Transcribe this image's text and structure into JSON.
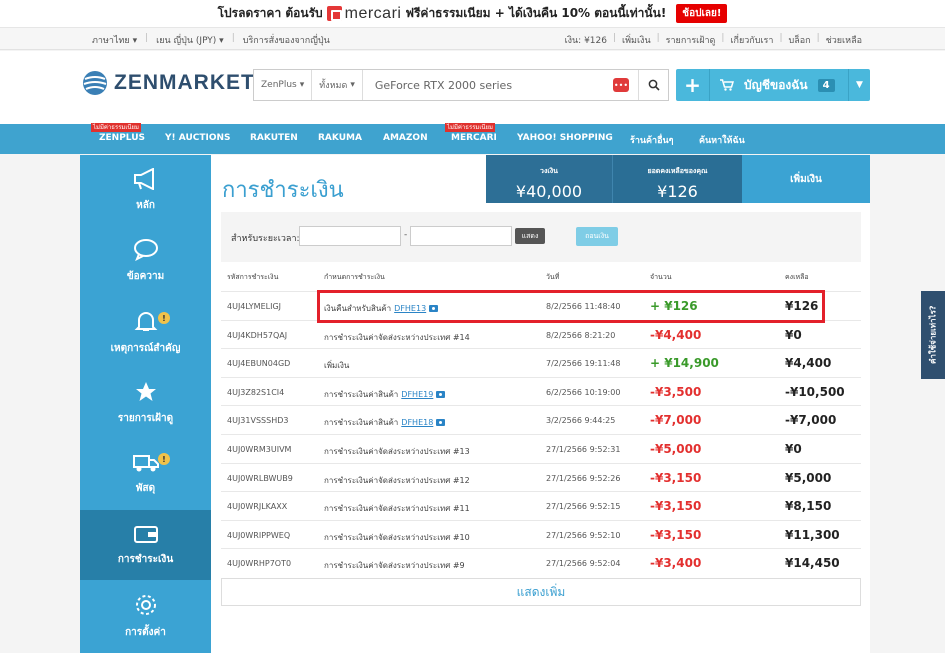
{
  "promo": {
    "prefix": "โปรลดราคา ต้อนรับ",
    "brand": "mercari",
    "suffix": "ฟรีค่าธรรมเนียม + ได้เงินคืน 10% ตอนนี้เท่านั้น!",
    "cta": "ช้อปเลย!"
  },
  "topbar": {
    "language": "ภาษาไทย ▾",
    "currency": "เยน ญี่ปุ่น (JPY) ▾",
    "service": "บริการสั่งของจากญี่ปุ่น",
    "links": [
      "เงิน: ¥126",
      "เพิ่มเงิน",
      "รายการเฝ้าดู",
      "เกี่ยวกับเรา",
      "บล็อก",
      "ช่วยเหลือ"
    ]
  },
  "header": {
    "logo": "ZENMARKET",
    "store_select": "ZenPlus",
    "category_select": "ทั้งหมด",
    "search_value": "GeForce RTX 2000 series",
    "account_label": "บัญชีของฉัน",
    "cart_count": "4"
  },
  "nav": {
    "items": [
      "ZENPLUS",
      "Y! AUCTIONS",
      "RAKUTEN",
      "RAKUMA",
      "AMAZON",
      "MERCARI",
      "YAHOO! SHOPPING",
      "ร้านค้าอื่นๆ",
      "ค้นหาให้ฉัน"
    ],
    "badge": "ไม่มีค่าธรรมเนียม"
  },
  "sidebar": {
    "items": [
      "หลัก",
      "ข้อความ",
      "เหตุการณ์สำคัญ",
      "รายการเฝ้าดู",
      "พัสดุ",
      "การชำระเงิน",
      "การตั้งค่า"
    ],
    "notif_count": "!"
  },
  "page": {
    "title": "การชำระเงิน",
    "credit_label": "วงเงิน",
    "credit_value": "¥40,000",
    "balance_label": "ยอดคงเหลือของคุณ",
    "balance_value": "¥126",
    "add_funds": "เพิ่มเงิน"
  },
  "filter": {
    "label": "สำหรับระยะเวลา:",
    "dash": "-",
    "show": "แสดง",
    "withdraw": "ถอนเงิน"
  },
  "table": {
    "headers": [
      "รหัสการชำระเงิน",
      "กำหนดการชำระเงิน",
      "วันที่",
      "จำนวน",
      "คงเหลือ"
    ],
    "rows": [
      {
        "id": "4UJ4LYMELIGJ",
        "desc": "เงินคืนสำหรับสินค้า",
        "link": "DFHE13",
        "date": "8/2/2566 11:48:40",
        "amount": "+ ¥126",
        "balance": "¥126"
      },
      {
        "id": "4UJ4KDH57QAJ",
        "desc": "การชำระเงินค่าจัดส่งระหว่างประเทศ #14",
        "link": "",
        "date": "8/2/2566 8:21:20",
        "amount": "-¥4,400",
        "balance": "¥0"
      },
      {
        "id": "4UJ4EBUN04GD",
        "desc": "เพิ่มเงิน",
        "link": "",
        "date": "7/2/2566 19:11:48",
        "amount": "+ ¥14,900",
        "balance": "¥4,400"
      },
      {
        "id": "4UJ3Z82S1CI4",
        "desc": "การชำระเงินค่าสินค้า",
        "link": "DFHE19",
        "date": "6/2/2566 10:19:00",
        "amount": "-¥3,500",
        "balance": "-¥10,500"
      },
      {
        "id": "4UJ31VSSSHD3",
        "desc": "การชำระเงินค่าสินค้า",
        "link": "DFHE18",
        "date": "3/2/2566 9:44:25",
        "amount": "-¥7,000",
        "balance": "-¥7,000"
      },
      {
        "id": "4UJ0WRM3UIVM",
        "desc": "การชำระเงินค่าจัดส่งระหว่างประเทศ #13",
        "link": "",
        "date": "27/1/2566 9:52:31",
        "amount": "-¥5,000",
        "balance": "¥0"
      },
      {
        "id": "4UJ0WRLBWUB9",
        "desc": "การชำระเงินค่าจัดส่งระหว่างประเทศ #12",
        "link": "",
        "date": "27/1/2566 9:52:26",
        "amount": "-¥3,150",
        "balance": "¥5,000"
      },
      {
        "id": "4UJ0WRJLKAXX",
        "desc": "การชำระเงินค่าจัดส่งระหว่างประเทศ #11",
        "link": "",
        "date": "27/1/2566 9:52:15",
        "amount": "-¥3,150",
        "balance": "¥8,150"
      },
      {
        "id": "4UJ0WRIPPWEQ",
        "desc": "การชำระเงินค่าจัดส่งระหว่างประเทศ #10",
        "link": "",
        "date": "27/1/2566 9:52:10",
        "amount": "-¥3,150",
        "balance": "¥11,300"
      },
      {
        "id": "4UJ0WRHP7OT0",
        "desc": "การชำระเงินค่าจัดส่งระหว่างประเทศ #9",
        "link": "",
        "date": "27/1/2566 9:52:04",
        "amount": "-¥3,400",
        "balance": "¥14,450"
      }
    ],
    "show_more": "แสดงเพิ่ม"
  },
  "help_tab": "คำใช้จ่ายเท่าไร?"
}
